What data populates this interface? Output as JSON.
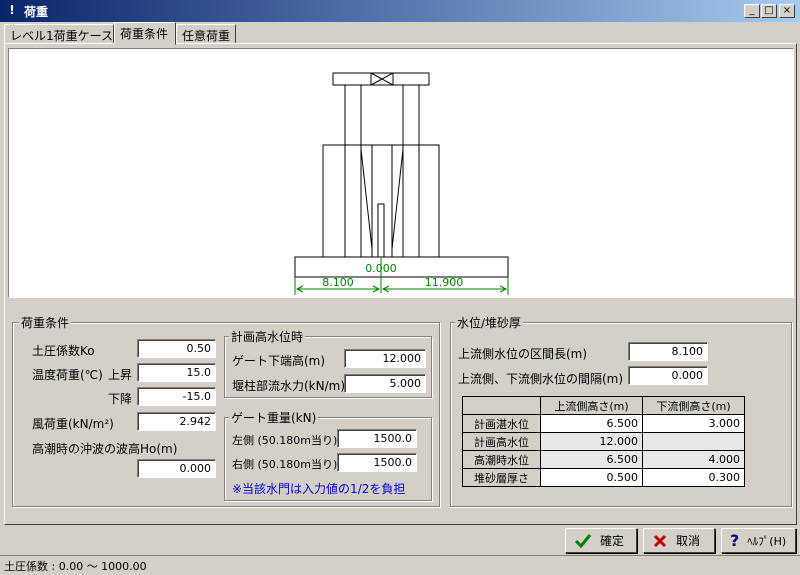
{
  "window": {
    "title": "荷重",
    "minimize": "_",
    "maximize": "□",
    "close": "×"
  },
  "tabs": [
    {
      "label": "レベル1荷重ケース"
    },
    {
      "label": "荷重条件"
    },
    {
      "label": "任意荷重"
    }
  ],
  "drawing": {
    "center_dim": "0.000",
    "left_dim": "8.100",
    "right_dim": "11.900"
  },
  "load_conditions": {
    "title": "荷重条件",
    "soil_coef_label": "土圧係数Ko",
    "soil_coef": "0.50",
    "temp_label": "温度荷重(℃)",
    "rise_label": "上昇",
    "rise": "15.0",
    "fall_label": "下降",
    "fall": "-15.0",
    "wind_label": "風荷重(kN/m²)",
    "wind": "2.942",
    "wave_label": "高潮時の沖波の波高Ho(m)",
    "wave": "0.000",
    "plan_title": "計画高水位時",
    "gate_bottom_label": "ゲート下端高(m)",
    "gate_bottom": "12.000",
    "pier_flow_label": "堰柱部流水力(kN/m)",
    "pier_flow": "5.000",
    "gate_weight_title": "ゲート重量(kN)",
    "left_label": "左側 (50.180m当り)",
    "left": "1500.0",
    "right_label": "右側 (50.180m当り)",
    "right": "1500.0",
    "note": "※当該水門は入力値の1/2を負担"
  },
  "water_level": {
    "title": "水位/堆砂厚",
    "upstream_len_label": "上流側水位の区間長(m)",
    "upstream_len": "8.100",
    "gap_label": "上流側、下流側水位の間隔(m)",
    "gap": "0.000",
    "table_headers": [
      "",
      "上流側高さ(m)",
      "下流側高さ(m)"
    ],
    "rows": [
      {
        "name": "計画湛水位",
        "up": "6.500",
        "down": "3.000"
      },
      {
        "name": "計画高水位",
        "up": "12.000",
        "down": ""
      },
      {
        "name": "高潮時水位",
        "up": "6.500",
        "down": "4.000"
      },
      {
        "name": "堆砂層厚さ",
        "up": "0.500",
        "down": "0.300"
      }
    ]
  },
  "buttons": {
    "ok": "確定",
    "cancel": "取消",
    "help": "ﾍﾙﾌﾟ(H)"
  },
  "status": "土圧係数 : 0.00 〜 1000.00",
  "colors": {
    "title_start": "#0a246a",
    "title_end": "#a6caf0",
    "dim": "#008000",
    "note": "#0000e0",
    "ok_icon": "#008000",
    "cancel_icon": "#c00000"
  }
}
